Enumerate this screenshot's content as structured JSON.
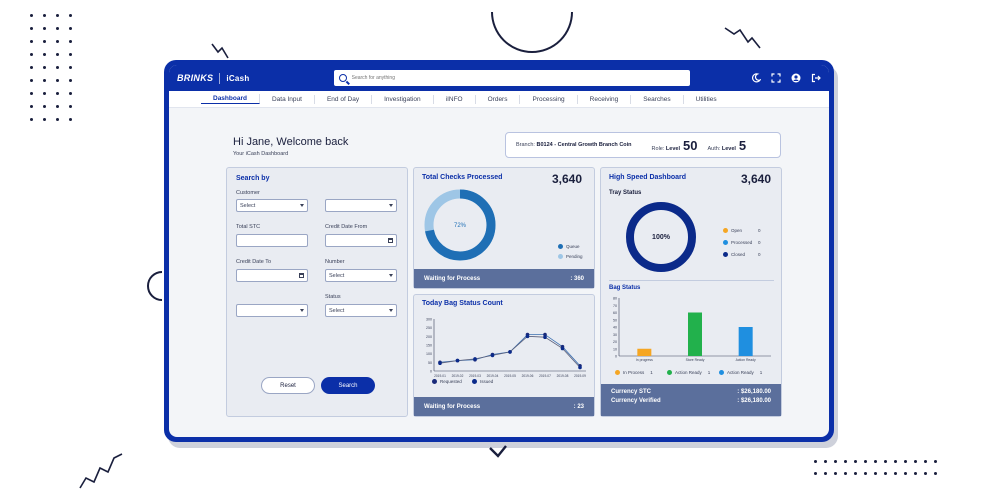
{
  "brand": {
    "logo": "BRINKS",
    "app": "iCash"
  },
  "search": {
    "placeholder": "Search for anything"
  },
  "nav": {
    "items": [
      "Dashboard",
      "Data Input",
      "End of Day",
      "Investigation",
      "iINFO",
      "Orders",
      "Processing",
      "Receiving",
      "Searches",
      "Utilities"
    ],
    "active": "Dashboard"
  },
  "welcome": {
    "title": "Hi Jane, Welcome back",
    "subtitle": "Your iCash Dashboard"
  },
  "info": {
    "branch_label": "Branch:",
    "branch_value": "B0124 - Central Growth Branch Coin",
    "role_label": "Role:",
    "role_level_label": "Level",
    "role_level": "50",
    "auth_label": "Auth:",
    "auth_level_label": "Level",
    "auth_level": "5"
  },
  "search_panel": {
    "title": "Search by",
    "customer_label": "Customer",
    "select_text": "Select",
    "total_stc_label": "Total STC",
    "credit_date_from_label": "Credit Date From",
    "credit_date_to_label": "Credit Date To",
    "number_label": "Number",
    "status_label": "Status",
    "reset_label": "Reset",
    "search_label": "Search"
  },
  "checks": {
    "title": "Total Checks Processed",
    "total": "3,640",
    "percent": "72%",
    "legend": [
      "Queue",
      "Pending"
    ],
    "footer_label": "Waiting for Process",
    "footer_value": ": 360",
    "colors": {
      "queue": "#1f6fb5",
      "pending": "#9ec6e6"
    }
  },
  "bag_status": {
    "title": "Today Bag Status Count",
    "legend": [
      "Requested",
      "Issued"
    ],
    "footer_label": "Waiting for Process",
    "footer_value": ": 23"
  },
  "high_speed": {
    "title": "High Speed Dashboard",
    "total": "3,640",
    "tray_title": "Tray Status",
    "tray_percent": "100%",
    "tray_legend": [
      {
        "label": "Open",
        "value": "0",
        "color": "#f5a623"
      },
      {
        "label": "Processed",
        "value": "0",
        "color": "#1f8fe0"
      },
      {
        "label": "Closed",
        "value": "0",
        "color": "#0b2a8a"
      }
    ],
    "bag_title": "Bag Status",
    "bag_legend": [
      {
        "label": "In Process",
        "value": "1",
        "color": "#f5a623"
      },
      {
        "label": "Action Ready",
        "value": "1",
        "color": "#22b14c"
      },
      {
        "label": "Action Ready",
        "value": "1",
        "color": "#1f8fe0"
      }
    ],
    "currency_stc_label": "Currency STC",
    "currency_stc_value": ": $26,180.00",
    "currency_verified_label": "Currency Verified",
    "currency_verified_value": ": $26,180.00"
  },
  "chart_data": [
    {
      "type": "line",
      "x": [
        "2019-01",
        "2019-02",
        "2019-03",
        "2019-04",
        "2019-05",
        "2019-06",
        "2019-07",
        "2019-08",
        "2019-09"
      ],
      "series": [
        {
          "name": "Requested",
          "values": [
            50,
            60,
            65,
            95,
            110,
            210,
            210,
            140,
            30
          ]
        },
        {
          "name": "Issued",
          "values": [
            45,
            60,
            70,
            90,
            110,
            200,
            195,
            130,
            20
          ]
        }
      ],
      "ylim": [
        0,
        300
      ],
      "yticks": [
        "0",
        "50",
        "100",
        "150",
        "200",
        "250",
        "300"
      ],
      "legend": "bottom",
      "grid": false
    },
    {
      "type": "bar",
      "categories": [
        "In progress",
        "Store Ready",
        "Action Ready"
      ],
      "values": [
        10,
        60,
        40
      ],
      "ylim": [
        0,
        80
      ],
      "yticks": [
        "0",
        "10",
        "20",
        "30",
        "40",
        "50",
        "60",
        "70",
        "80"
      ],
      "colors": [
        "#f5a623",
        "#22b14c",
        "#1f8fe0"
      ]
    }
  ]
}
